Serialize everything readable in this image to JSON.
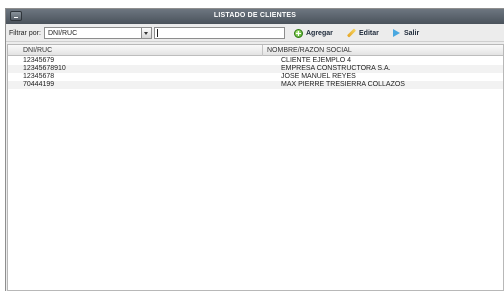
{
  "window": {
    "title": "LISTADO DE CLIENTES"
  },
  "toolbar": {
    "filter_label": "Filtrar por:",
    "filter_value": "DNI/RUC",
    "search_value": "",
    "agregar_label": "Agregar",
    "editar_label": "Editar",
    "salir_label": "Salir"
  },
  "table": {
    "columns": [
      "DNI/RUC",
      "NOMBRE/RAZON SOCIAL"
    ],
    "rows": [
      [
        "12345679",
        "CLIENTE EJEMPLO 4"
      ],
      [
        "12345678910",
        "EMPRESA CONSTRUCTORA S.A."
      ],
      [
        "12345678",
        "JOSE MANUEL REYES"
      ],
      [
        "70444199",
        "MAX PIERRE TRESIERRA COLLAZOS"
      ]
    ]
  }
}
